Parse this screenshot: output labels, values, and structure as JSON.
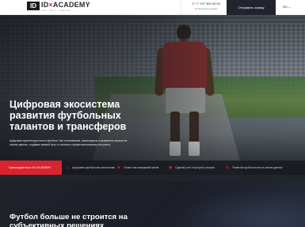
{
  "header": {
    "logo_badge": "ID",
    "logo_name_a": "ID",
    "logo_name_x": "×",
    "logo_name_b": "ACADEMY",
    "logo_tagline": "Тест · Бенч · Скаутинг",
    "phone": "+7 707 369 33 69",
    "email": "info@academy.digital",
    "cta_label": "Отправить заявку",
    "language": "RU ⌄"
  },
  "hero": {
    "title": "Цифровая экосистема развития футбольных талантов и трансферов",
    "description": "Цифровая архитектура нового футбола. Мы отслеживаем, анализируем и развиваем игроков на основе данных, создавая прямой путь от таланта к профессиональному контракту."
  },
  "strip": {
    "cta_label": "Присоединиться к ID ACADEMY",
    "items": [
      {
        "label": "Цифровая футбольная экосистема"
      },
      {
        "label": "Талант как измеримый актив"
      },
      {
        "label": "Единый учет и прогресс игроков"
      },
      {
        "label": "Развитие футболистов на основе данных"
      }
    ]
  },
  "section_two": {
    "title": "Футбол больше не строится на субъективных решениях"
  }
}
